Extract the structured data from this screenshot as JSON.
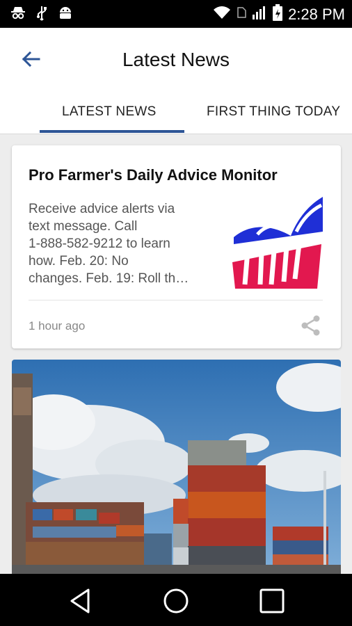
{
  "status": {
    "time": "2:28 PM"
  },
  "app_bar": {
    "title": "Latest News"
  },
  "tabs": [
    {
      "label": "LATEST NEWS"
    },
    {
      "label": "FIRST THING TODAY"
    }
  ],
  "articles": [
    {
      "title": "Pro Farmer's Daily Advice Monitor",
      "body": "Receive advice alerts via\ntext message. Call\n1-888-582-9212 to learn\nhow.       Feb. 20: No\nchanges.     Feb. 19: Roll th…",
      "time_ago": "1 hour ago"
    }
  ],
  "colors": {
    "accent": "#2d5596",
    "logo_red": "#e2184f",
    "logo_blue": "#1f2fd6"
  }
}
